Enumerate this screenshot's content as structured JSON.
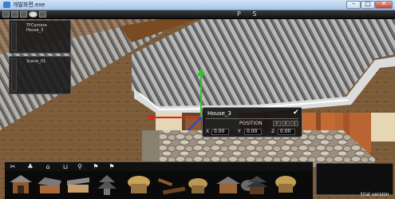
{
  "window": {
    "title": "개발화면.exe",
    "minimize_glyph": "–",
    "maximize_glyph": "□",
    "close_glyph": "✕"
  },
  "toolbar": {
    "buttons": [
      "menu-icon",
      "save-icon",
      "open-icon",
      "play-icon",
      "settings-icon"
    ],
    "mode_label": "P S"
  },
  "panels": [
    {
      "label_line1": "TPCamera",
      "label_line2": "House_3"
    },
    {
      "label_line1": "Scene_01",
      "label_line2": ""
    }
  ],
  "property_panel": {
    "object_name": "House_3",
    "section_title": "POSITION",
    "mini_buttons": [
      "P",
      "R",
      "S"
    ],
    "x_label": "X",
    "x_value": "0.00",
    "y_label": "Y",
    "y_value": "0.00",
    "z_label": "Z",
    "z_value": "0.00"
  },
  "category_bar": {
    "icons": [
      "scissors-icon",
      "tree-icon",
      "house-icon",
      "cart-icon",
      "pin-icon",
      "flag-icon",
      "flag-icon"
    ]
  },
  "items": [
    "hanok-gate",
    "long-hanok",
    "hanok-wall",
    "pagoda",
    "straw-house",
    "wood-pile",
    "plank",
    "straw-hut",
    "tiled-house",
    "rock",
    "straw-hut-2",
    "palace",
    "straw-house-2"
  ],
  "footer": {
    "trial_text": "trial version"
  },
  "colors": {
    "gizmo_y": "#22cc22",
    "gizmo_x": "#dd2222",
    "gizmo_z": "#2244dd"
  }
}
